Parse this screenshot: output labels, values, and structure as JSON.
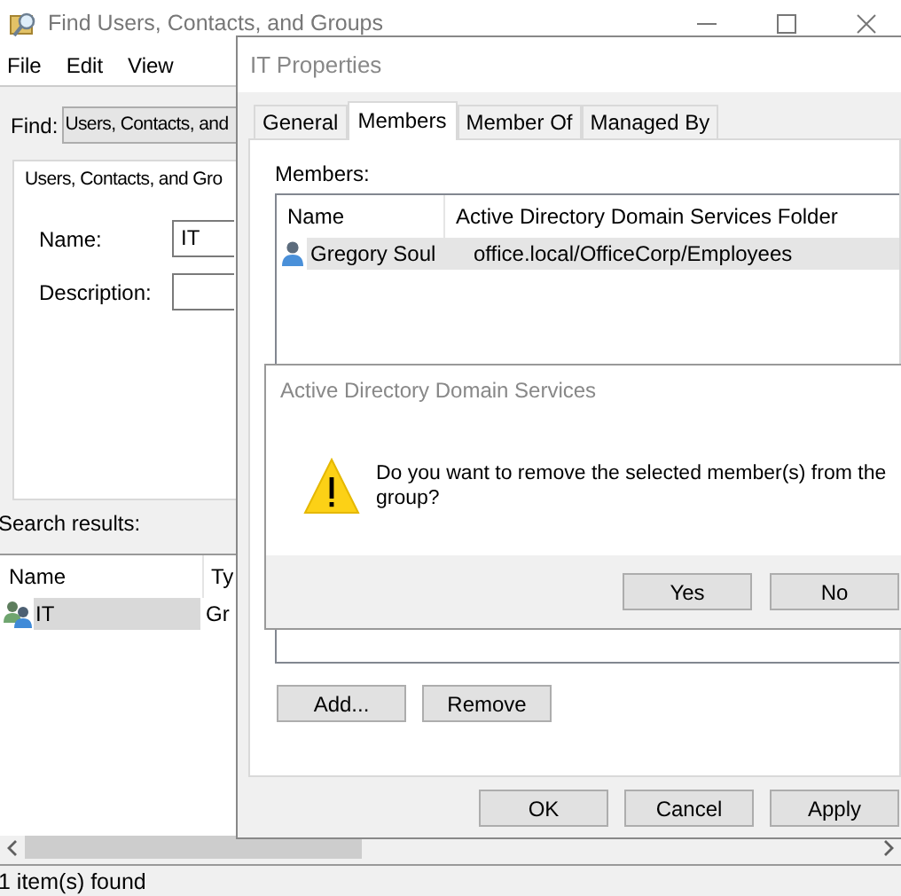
{
  "find_window": {
    "title": "Find Users, Contacts, and Groups",
    "menu": [
      "File",
      "Edit",
      "View"
    ],
    "find_label": "Find:",
    "find_value": "Users, Contacts, and",
    "tab_label": "Users, Contacts, and Gro",
    "fields": [
      {
        "label": "Name:",
        "value": "IT"
      },
      {
        "label": "Description:"
      }
    ],
    "results_label": "Search results:",
    "results": {
      "columns": [
        "Name",
        "Ty"
      ],
      "rows": [
        {
          "name": "IT",
          "type": "Gr",
          "selected": true
        }
      ]
    },
    "status_bar": "1 item(s) found"
  },
  "properties_window": {
    "title": "IT Properties",
    "tabs": [
      {
        "label": "General",
        "selected": false
      },
      {
        "label": "Members",
        "selected": true
      },
      {
        "label": "Member Of",
        "selected": false
      },
      {
        "label": "Managed By",
        "selected": false
      }
    ],
    "members_label": "Members:",
    "members": {
      "columns": [
        "Name",
        "Active Directory Domain Services Folder"
      ],
      "rows": [
        {
          "name": "Gregory Soul",
          "folder": "office.local/OfficeCorp/Employees",
          "selected": true
        }
      ]
    },
    "buttons": [
      "Add...",
      "Remove"
    ],
    "footer_buttons": [
      "OK",
      "Cancel",
      "Apply"
    ]
  },
  "dialog": {
    "title": "Active Directory Domain Services",
    "message": "Do you want to remove the selected member(s) from the group?",
    "buttons": [
      "Yes",
      "No"
    ]
  }
}
